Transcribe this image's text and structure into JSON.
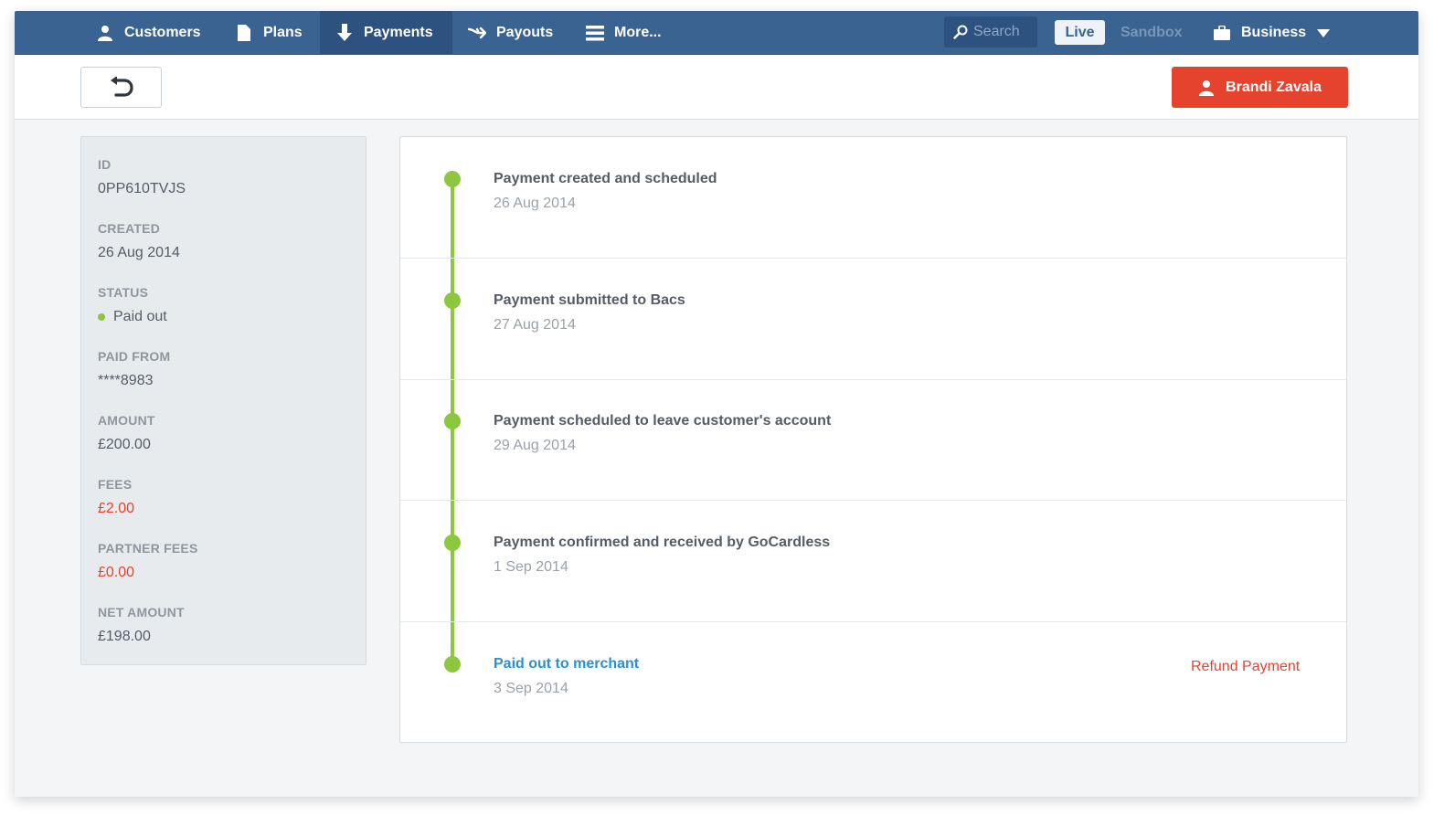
{
  "nav": {
    "items": [
      {
        "label": "Customers",
        "icon": "user-icon"
      },
      {
        "label": "Plans",
        "icon": "document-icon"
      },
      {
        "label": "Payments",
        "icon": "arrow-down-icon",
        "active": true
      },
      {
        "label": "Payouts",
        "icon": "payout-arrow-icon"
      },
      {
        "label": "More...",
        "icon": "hamburger-icon"
      }
    ],
    "search_placeholder": "Search",
    "env_live": "Live",
    "env_sandbox": "Sandbox",
    "business_label": "Business"
  },
  "subheader": {
    "customer_name": "Brandi Zavala"
  },
  "details": {
    "fields": [
      {
        "label": "ID",
        "value": "0PP610TVJS"
      },
      {
        "label": "CREATED",
        "value": "26 Aug 2014"
      },
      {
        "label": "STATUS",
        "value": "Paid out"
      },
      {
        "label": "PAID FROM",
        "value": "****8983"
      },
      {
        "label": "AMOUNT",
        "value": "£200.00"
      },
      {
        "label": "FEES",
        "value": "£2.00"
      },
      {
        "label": "PARTNER FEES",
        "value": "£0.00"
      },
      {
        "label": "NET AMOUNT",
        "value": "£198.00"
      }
    ]
  },
  "timeline": {
    "events": [
      {
        "title": "Payment created and scheduled",
        "date": "26 Aug 2014"
      },
      {
        "title": "Payment submitted to Bacs",
        "date": "27 Aug 2014"
      },
      {
        "title": "Payment scheduled to leave customer's account",
        "date": "29 Aug 2014"
      },
      {
        "title": "Payment confirmed and received by GoCardless",
        "date": "1 Sep 2014"
      },
      {
        "title": "Paid out to merchant",
        "date": "3 Sep 2014"
      }
    ],
    "refund_label": "Refund Payment"
  },
  "colors": {
    "nav_bg": "#3a6391",
    "accent_red": "#e5432e",
    "status_green": "#8dc63f",
    "link_blue": "#2b8fd0"
  }
}
